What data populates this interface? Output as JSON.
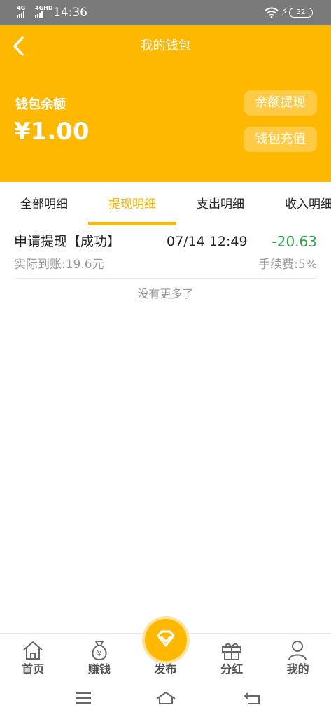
{
  "status_bar": {
    "network_1": "4G",
    "network_2": "4GHD",
    "time": "14:36",
    "battery": "32"
  },
  "header": {
    "title": "我的钱包",
    "balance_label": "钱包余额",
    "balance_value": "¥1.00",
    "withdraw_label": "余额提现",
    "recharge_label": "钱包充值"
  },
  "tabs": [
    {
      "label": "全部明细"
    },
    {
      "label": "提现明细"
    },
    {
      "label": "支出明细"
    },
    {
      "label": "收入明细"
    }
  ],
  "active_tab": "提现明细",
  "records": [
    {
      "title": "申请提现【成功】",
      "time": "07/14 12:49",
      "amount": "-20.63",
      "actual": "实际到账:19.6元",
      "fee": "手续费:5%"
    }
  ],
  "no_more_text": "没有更多了",
  "bottom_nav": [
    {
      "label": "首页",
      "icon": "home-icon"
    },
    {
      "label": "赚钱",
      "icon": "money-bag-icon"
    },
    {
      "label": "发布",
      "icon": "diamond-icon"
    },
    {
      "label": "分红",
      "icon": "gift-icon"
    },
    {
      "label": "我的",
      "icon": "user-icon"
    }
  ],
  "colors": {
    "accent": "#ffb800",
    "negative_amount": "#2aa84a",
    "status_bar": "#7a7a7a"
  }
}
